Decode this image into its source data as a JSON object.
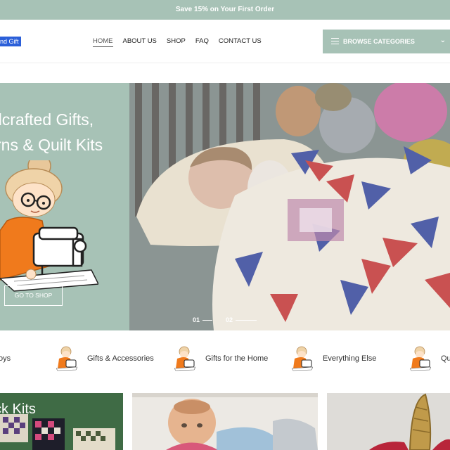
{
  "announcement": {
    "text": "Save 15% on Your First Order"
  },
  "header": {
    "logo_fragment": "nd Gift",
    "nav": [
      {
        "label": "HOME"
      },
      {
        "label": "ABOUT US"
      },
      {
        "label": "SHOP"
      },
      {
        "label": "FAQ"
      },
      {
        "label": "CONTACT US"
      }
    ],
    "browse_label": "BROWSE CATEGORIES",
    "browse_chevron": "⌄"
  },
  "hero": {
    "title_line1": "dcrafted Gifts,",
    "title_line2": "rns & Quilt Kits",
    "button_label": "GO TO SHOP",
    "slides": [
      {
        "label": "01"
      },
      {
        "label": "02"
      }
    ]
  },
  "categories": [
    {
      "label": "oys"
    },
    {
      "label": "Gifts & Accessories"
    },
    {
      "label": "Gifts for the Home"
    },
    {
      "label": "Everything Else"
    },
    {
      "label": "Qu"
    }
  ],
  "cards": [
    {
      "title": "ck Kits"
    },
    {
      "title": ""
    },
    {
      "title": ""
    }
  ],
  "colors": {
    "accent": "#a7c2b6",
    "logo_blue": "#2b5fd9"
  }
}
